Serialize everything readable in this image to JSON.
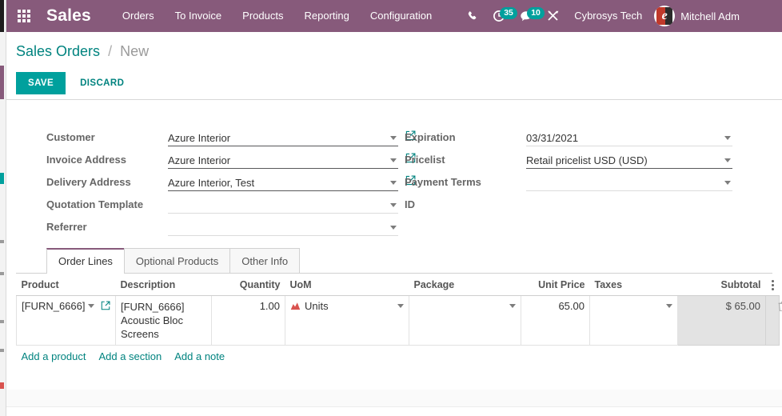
{
  "navbar": {
    "apps_icon": "apps-grid-icon",
    "brand": "Sales",
    "menu": [
      {
        "label": "Orders"
      },
      {
        "label": "To Invoice"
      },
      {
        "label": "Products"
      },
      {
        "label": "Reporting"
      },
      {
        "label": "Configuration"
      }
    ],
    "icons": {
      "phone": "phone-icon",
      "activity": "clock-activity-icon",
      "messages": "chat-bubble-icon",
      "debug": "wrench-tools-icon"
    },
    "activity_count": "35",
    "message_count": "10",
    "company": "Cybrosys Tech",
    "user": "Mitchell Adm",
    "avatar_letter": "e",
    "bg_color": "#875a7b",
    "badge_color": "#00a09d"
  },
  "control_panel": {
    "breadcrumb_root": "Sales Orders",
    "breadcrumb_sep": "/",
    "breadcrumb_current": "New",
    "save_label": "SAVE",
    "discard_label": "DISCARD",
    "save_color": "#00a09d",
    "link_color": "#00837f"
  },
  "form": {
    "left": [
      {
        "label": "Customer",
        "value": "Azure Interior",
        "filled": true,
        "external": true
      },
      {
        "label": "Invoice Address",
        "value": "Azure Interior",
        "filled": true,
        "external": true
      },
      {
        "label": "Delivery Address",
        "value": "Azure Interior, Test",
        "filled": true,
        "external": true
      },
      {
        "label": "Quotation Template",
        "value": "",
        "filled": false,
        "external": false
      },
      {
        "label": "Referrer",
        "value": "",
        "filled": false,
        "external": false
      }
    ],
    "right": [
      {
        "label": "Expiration",
        "value": "03/31/2021",
        "filled": false,
        "external": false
      },
      {
        "label": "Pricelist",
        "value": "Retail pricelist USD (USD)",
        "filled": true,
        "external": false
      },
      {
        "label": "Payment Terms",
        "value": "",
        "filled": false,
        "external": false
      },
      {
        "label": "ID",
        "value": "",
        "filled": false,
        "external": false,
        "no_input": true
      }
    ]
  },
  "notebook": {
    "tabs": [
      {
        "label": "Order Lines",
        "active": true
      },
      {
        "label": "Optional Products",
        "active": false
      },
      {
        "label": "Other Info",
        "active": false
      }
    ],
    "active_border_color": "#875a7b"
  },
  "order_lines": {
    "columns": [
      {
        "label": "Product",
        "align": "left"
      },
      {
        "label": "Description",
        "align": "left"
      },
      {
        "label": "Quantity",
        "align": "right"
      },
      {
        "label": "UoM",
        "align": "left"
      },
      {
        "label": "Package",
        "align": "left"
      },
      {
        "label": "Unit Price",
        "align": "right"
      },
      {
        "label": "Taxes",
        "align": "left"
      },
      {
        "label": "Subtotal",
        "align": "right"
      }
    ],
    "options_icon": "vertical-dots-icon",
    "rows": [
      {
        "product": "[FURN_6666]",
        "description": "[FURN_6666] Acoustic Bloc Screens",
        "quantity": "1.00",
        "uom": "Units",
        "uom_forecast_icon": "forecast-chart-icon",
        "package": "",
        "unit_price": "65.00",
        "taxes": "",
        "subtotal": "$ 65.00",
        "delete_icon": "trash-icon"
      }
    ],
    "add_links": [
      {
        "label": "Add a product"
      },
      {
        "label": "Add a section"
      },
      {
        "label": "Add a note"
      }
    ]
  }
}
